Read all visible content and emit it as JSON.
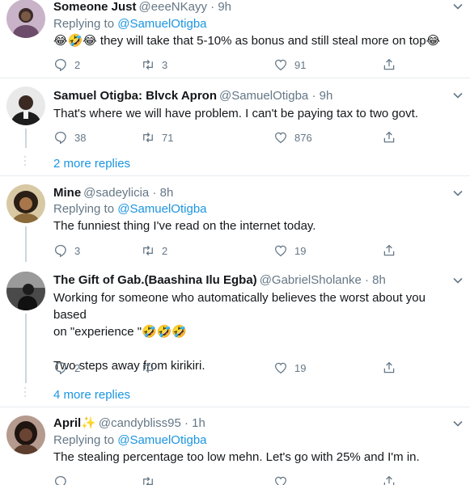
{
  "colors": {
    "link": "#1b95e0",
    "muted": "#657786",
    "text": "#14171a",
    "divider": "#e6ecf0"
  },
  "tweets": [
    {
      "name": "Someone Just",
      "handle": "@eeeNKayy",
      "dot": "·",
      "time": "9h",
      "replying_prefix": "Replying to ",
      "replying_to": "@SamuelOtigba",
      "text": "😂🤣😂 they will take that 5-10% as bonus and still steal more on top😂",
      "replies": "2",
      "retweets": "3",
      "likes": "91"
    },
    {
      "name": "Samuel Otigba: Blvck Apron",
      "handle": "@SamuelOtigba",
      "dot": "·",
      "time": "9h",
      "text": "That's where we will have problem. I can't be paying tax to two govt.",
      "replies": "38",
      "retweets": "71",
      "likes": "876",
      "more_replies": "2 more replies"
    },
    {
      "name": "Mine",
      "handle": "@sadeylicia",
      "dot": "·",
      "time": "8h",
      "replying_prefix": "Replying to ",
      "replying_to": "@SamuelOtigba",
      "text": "The funniest thing I've read on the internet today.",
      "replies": "3",
      "retweets": "2",
      "likes": "19"
    },
    {
      "name": "The Gift of Gab.(Baashina Ilu Egba)",
      "handle": "@GabrielSholanke",
      "dot": "·",
      "time": "8h",
      "text_line1": "Working for someone who automatically believes the worst about you based",
      "text_line2": "on \"experience \"🤣🤣🤣",
      "text_line3": "Two steps away from kirikiri.",
      "replies": "2",
      "retweets": "",
      "likes": "19",
      "more_replies": "4 more replies"
    },
    {
      "name": "April✨",
      "handle": "@candybliss95",
      "dot": "·",
      "time": "1h",
      "replying_prefix": "Replying to ",
      "replying_to": "@SamuelOtigba",
      "text": "The stealing percentage too low mehn. Let's go with 25% and I'm in."
    }
  ]
}
